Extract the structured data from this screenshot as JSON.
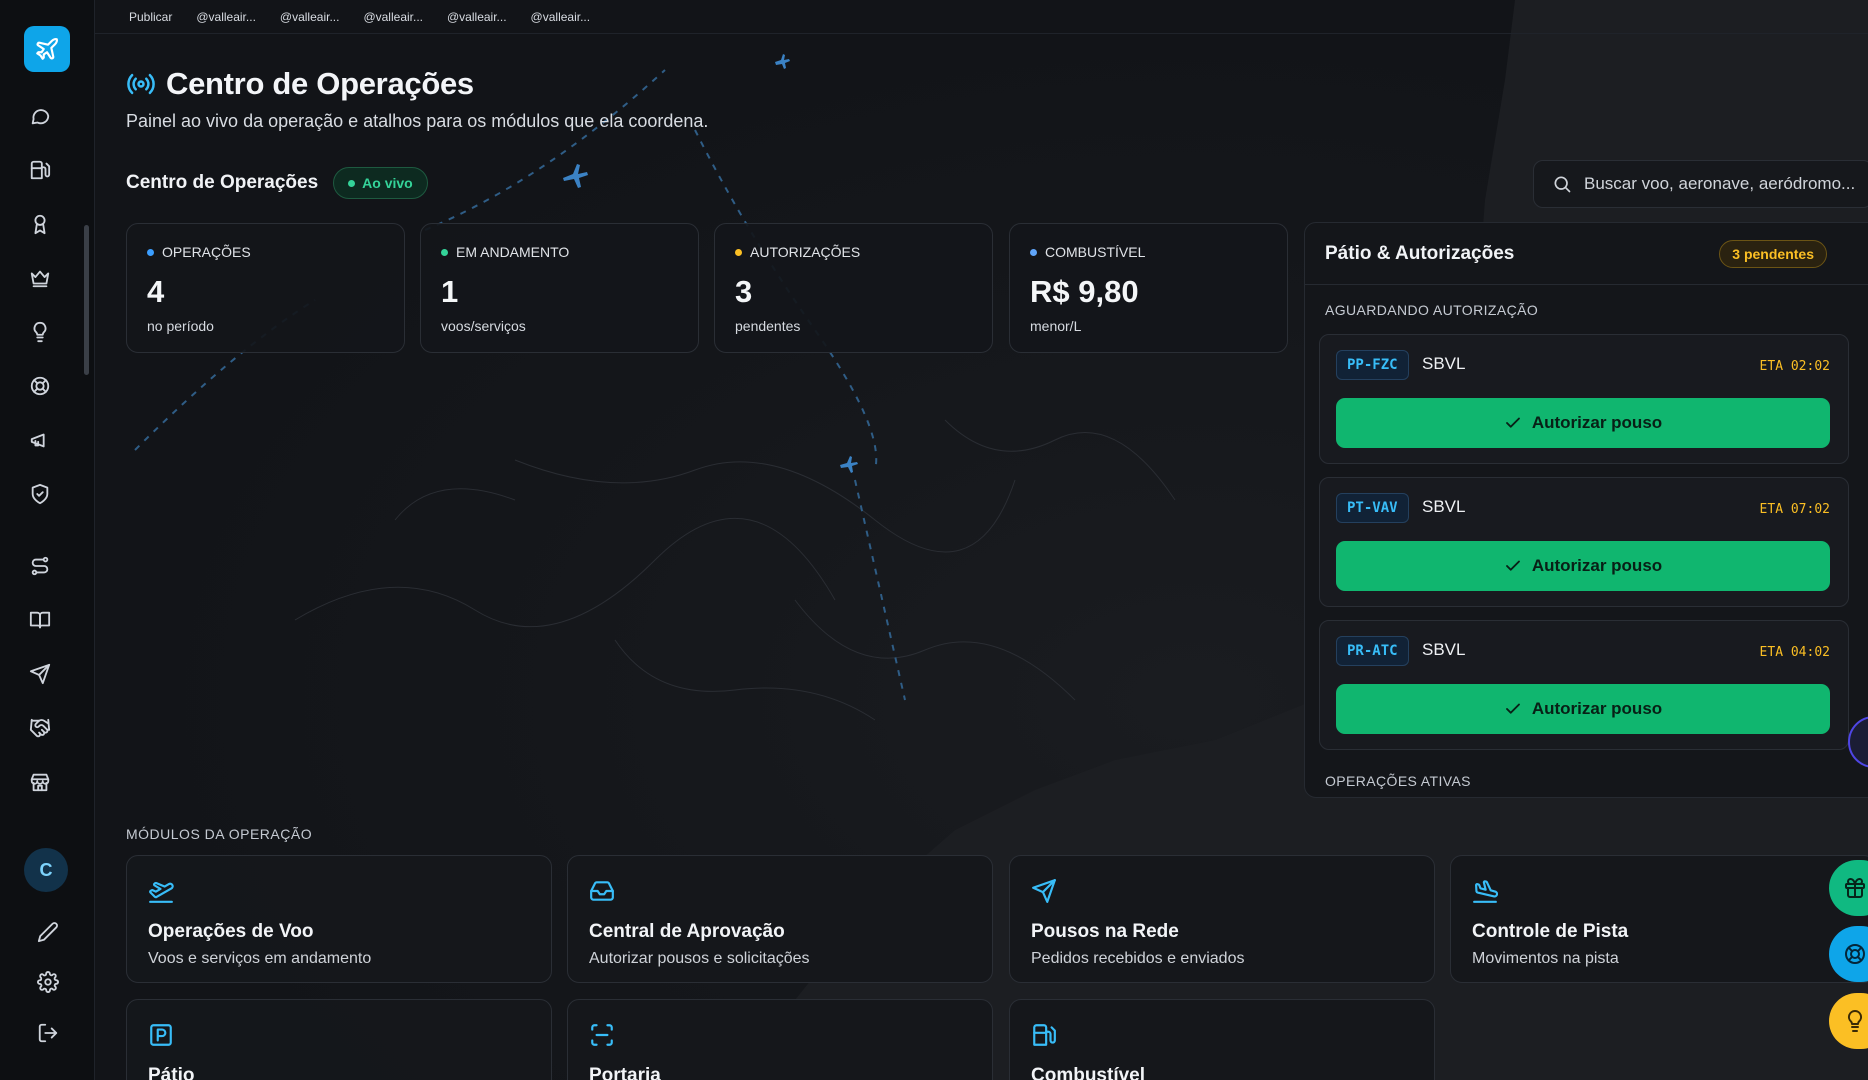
{
  "topbar": {
    "items": [
      "Publicar",
      "@valleair...",
      "@valleair...",
      "@valleair...",
      "@valleair...",
      "@valleair..."
    ]
  },
  "header": {
    "title": "Centro de Operações",
    "subtitle": "Painel ao vivo da operação e atalhos para os módulos que ela coordena."
  },
  "section": {
    "title": "Centro de Operações",
    "live_label": "Ao vivo"
  },
  "search": {
    "placeholder": "Buscar voo, aeronave, aeródromo..."
  },
  "kpis": [
    {
      "label": "OPERAÇÕES",
      "value": "4",
      "unit": "no período",
      "color": "#3b9eff"
    },
    {
      "label": "EM ANDAMENTO",
      "value": "1",
      "unit": "voos/serviços",
      "color": "#34d399"
    },
    {
      "label": "AUTORIZAÇÕES",
      "value": "3",
      "unit": "pendentes",
      "color": "#fbbf24"
    },
    {
      "label": "COMBUSTÍVEL",
      "value": "R$ 9,80",
      "unit": "menor/L",
      "color": "#60a5fa"
    }
  ],
  "panel": {
    "title": "Pátio & Autorizações",
    "pending_badge": "3 pendentes",
    "awaiting_label": "AGUARDANDO AUTORIZAÇÃO",
    "active_label": "OPERAÇÕES ATIVAS",
    "authorizations": [
      {
        "registration": "PP-FZC",
        "airport": "SBVL",
        "eta": "ETA 02:02",
        "action": "Autorizar pouso"
      },
      {
        "registration": "PT-VAV",
        "airport": "SBVL",
        "eta": "ETA 07:02",
        "action": "Autorizar pouso"
      },
      {
        "registration": "PR-ATC",
        "airport": "SBVL",
        "eta": "ETA 04:02",
        "action": "Autorizar pouso"
      }
    ]
  },
  "modules": {
    "label": "MÓDULOS DA OPERAÇÃO",
    "items": [
      {
        "icon": "plane-departure-icon",
        "title": "Operações de Voo",
        "desc": "Voos e serviços em andamento"
      },
      {
        "icon": "inbox-icon",
        "title": "Central de Aprovação",
        "desc": "Autorizar pousos e solicitações"
      },
      {
        "icon": "send-icon",
        "title": "Pousos na Rede",
        "desc": "Pedidos recebidos e enviados"
      },
      {
        "icon": "plane-landing-icon",
        "title": "Controle de Pista",
        "desc": "Movimentos na pista"
      },
      {
        "icon": "parking-icon",
        "title": "Pátio",
        "desc": ""
      },
      {
        "icon": "scan-icon",
        "title": "Portaria",
        "desc": ""
      },
      {
        "icon": "fuel-icon",
        "title": "Combustível",
        "desc": ""
      }
    ]
  },
  "user": {
    "initial": "C"
  },
  "colors": {
    "accent": "#0ea5e9",
    "success": "#10b66f",
    "warning": "#fbbf24",
    "background": "#111317"
  }
}
